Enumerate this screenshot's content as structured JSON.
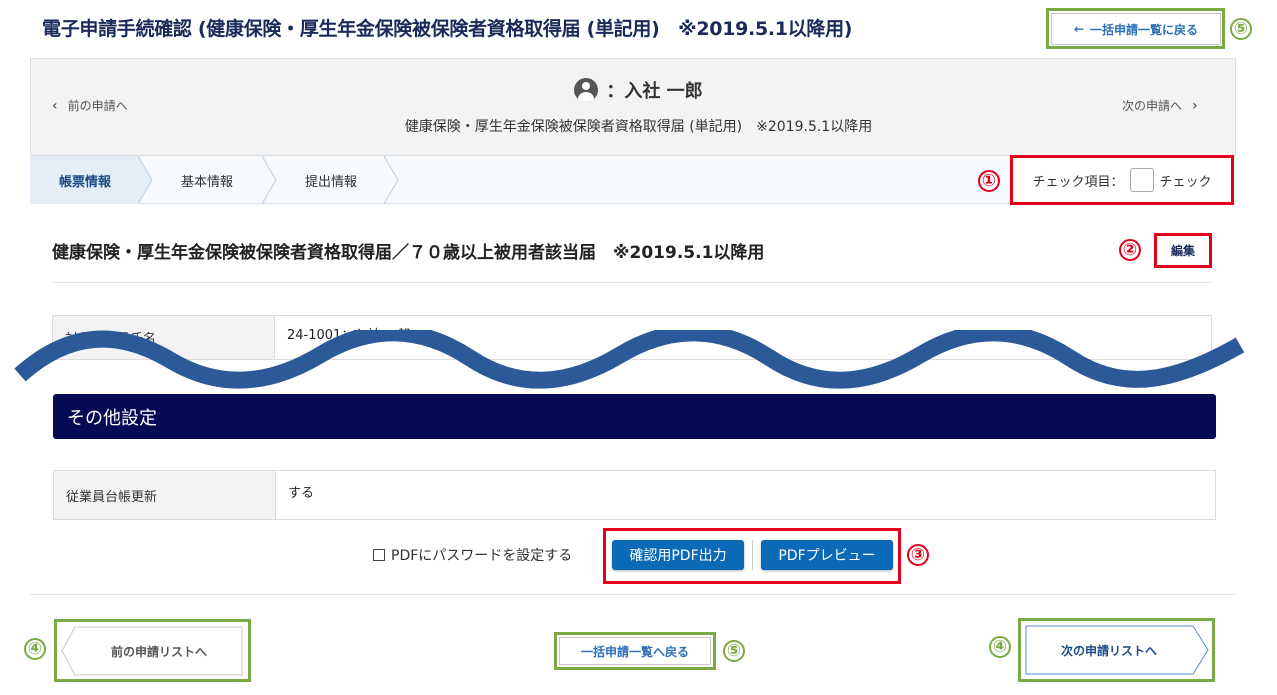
{
  "header": {
    "title": "電子申請手続確認 (健康保険・厚生年金保険被保険者資格取得届 (単記用)　※2019.5.1以降用)",
    "back_to_list_label": "一括申請一覧に戻る",
    "back_arrow": "←"
  },
  "nav": {
    "prev_label": "前の申請へ",
    "next_label": "次の申請へ",
    "prev_chevron": "‹",
    "next_chevron": "›",
    "employee_name": "：入社 一郎",
    "form_subtitle": "健康保険・厚生年金保険被保険者資格取得届 (単記用)　※2019.5.1以降用"
  },
  "tabs": [
    {
      "label": "帳票情報"
    },
    {
      "label": "基本情報"
    },
    {
      "label": "提出情報"
    }
  ],
  "check": {
    "label": "チェック項目：",
    "option": "チェック"
  },
  "form": {
    "title": "健康保険・厚生年金保険被保険者資格取得届／７０歳以上被用者該当届　※2019.5.1以降用",
    "edit_label": "編集",
    "target_employee_header": "対象従業員氏名",
    "target_employee_value": "24-1001：入社 一郎"
  },
  "other_settings": {
    "title": "その他設定",
    "rows": [
      {
        "header": "従業員台帳更新",
        "value": "する"
      }
    ]
  },
  "pdf": {
    "password_label": "PDFにパスワードを設定する",
    "output_button": "確認用PDF出力",
    "preview_button": "PDFプレビュー"
  },
  "footer": {
    "prev_list_label": "前の申請リストへ",
    "back_to_list_label": "一括申請一覧へ戻る",
    "next_list_label": "次の申請リストへ"
  },
  "annotations": [
    "①",
    "②",
    "③",
    "④",
    "⑤",
    "④",
    "⑤",
    "④",
    "⑤"
  ],
  "colors": {
    "accent_blue": "#0a6ab8",
    "section_navy": "#050a55",
    "annotation_red": "#e3001b",
    "annotation_green": "#7aaa43",
    "wave_blue": "#2c5a98"
  }
}
